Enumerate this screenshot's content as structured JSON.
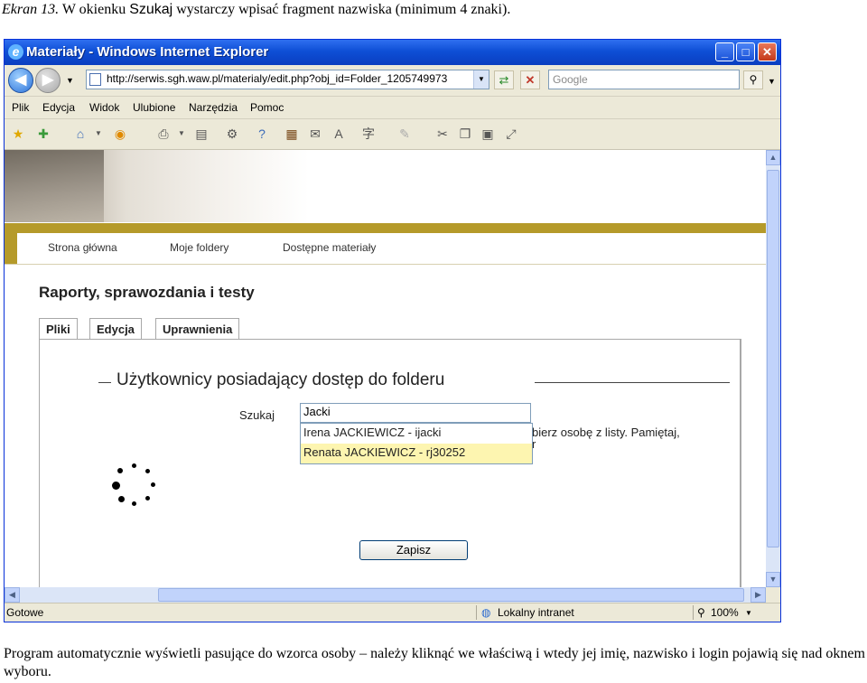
{
  "caption": {
    "label": "Ekran 13.",
    "text_before": "W okienku",
    "keyword": "Szukaj",
    "text_after": "wystarczy wpisać fragment nazwiska (minimum 4 znaki).",
    "bottom": "Program automatycznie wyświetli pasujące do wzorca osoby – należy kliknąć we właściwą i wtedy jej imię, nazwisko i login pojawią się nad oknem wyboru."
  },
  "browser": {
    "title": "Materiały - Windows Internet Explorer",
    "url": "http://serwis.sgh.waw.pl/materialy/edit.php?obj_id=Folder_1205749973",
    "search_placeholder": "Google",
    "menu": [
      "Plik",
      "Edycja",
      "Widok",
      "Ulubione",
      "Narzędzia",
      "Pomoc"
    ],
    "status_left": "Gotowe",
    "status_zone": "Lokalny intranet",
    "zoom": "100%"
  },
  "page": {
    "nav": [
      "Strona główna",
      "Moje foldery",
      "Dostępne materiały"
    ],
    "title": "Raporty, sprawozdania i testy",
    "tabs": [
      "Pliki",
      "Edycja",
      "Uprawnienia"
    ],
    "fieldset_legend": "Użytkownicy posiadający dostęp do folderu",
    "search_label": "Szukaj",
    "search_value": "Jacki",
    "hint_text": "bierz osobę z listy. Pamiętaj,",
    "hint_text2": "r",
    "suggestions": [
      "Irena JACKIEWICZ - ijacki",
      "Renata JACKIEWICZ - rj30252"
    ],
    "save_label": "Zapisz"
  }
}
